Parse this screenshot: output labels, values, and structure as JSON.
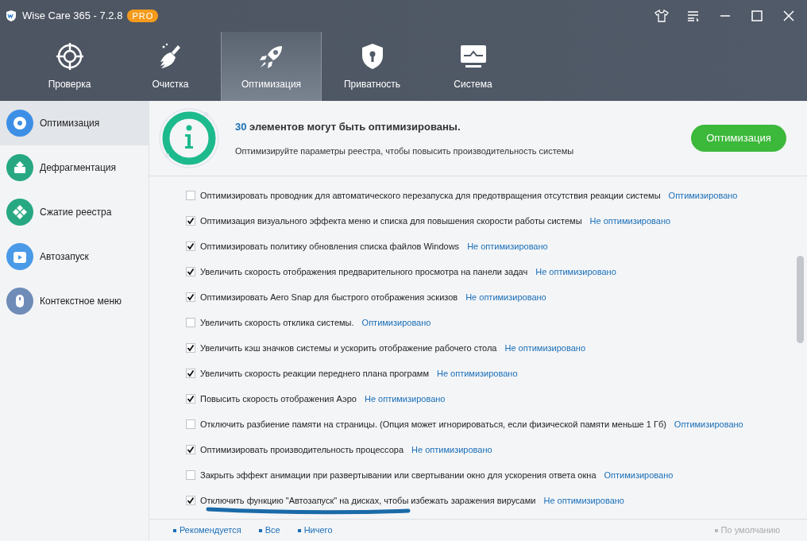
{
  "window": {
    "title": "Wise Care 365 - 7.2.8",
    "badge": "PRO"
  },
  "tabs": [
    {
      "label": "Проверка",
      "selected": false
    },
    {
      "label": "Очистка",
      "selected": false
    },
    {
      "label": "Оптимизация",
      "selected": true
    },
    {
      "label": "Приватность",
      "selected": false
    },
    {
      "label": "Система",
      "selected": false
    }
  ],
  "sidebar": {
    "items": [
      {
        "label": "Оптимизация",
        "color": "#3d8fe6",
        "selected": true
      },
      {
        "label": "Дефрагментация",
        "color": "#27a882",
        "selected": false
      },
      {
        "label": "Сжатие реестра",
        "color": "#27a882",
        "selected": false
      },
      {
        "label": "Автозапуск",
        "color": "#4a9ae8",
        "selected": false
      },
      {
        "label": "Контекстное меню",
        "color": "#6f8cb8",
        "selected": false
      }
    ]
  },
  "summary": {
    "count": "30",
    "title": "элементов могут быть оптимизированы.",
    "subtitle": "Оптимизируйте параметры реестра, чтобы повысить производительность системы",
    "button": "Оптимизация"
  },
  "items": [
    {
      "label": "Оптимизировать проводник для автоматического перезапуска для предотвращения отсутствия реакции системы",
      "status": "Оптимизировано",
      "checked": false
    },
    {
      "label": "Оптимизация визуального эффекта меню и списка для повышения скорости работы системы",
      "status": "Не оптимизировано",
      "checked": true
    },
    {
      "label": "Оптимизировать политику обновления списка файлов Windows",
      "status": "Не оптимизировано",
      "checked": true
    },
    {
      "label": "Увеличить скорость отображения предварительного просмотра на панели задач",
      "status": "Не оптимизировано",
      "checked": true
    },
    {
      "label": "Оптимизировать Aero Snap для быстрого отображения эскизов",
      "status": "Не оптимизировано",
      "checked": true
    },
    {
      "label": "Увеличить скорость отклика системы.",
      "status": "Оптимизировано",
      "checked": false
    },
    {
      "label": "Увеличить кэш значков системы и ускорить отображение рабочего стола",
      "status": "Не оптимизировано",
      "checked": true
    },
    {
      "label": "Увеличить скорость реакции переднего плана программ",
      "status": "Не оптимизировано",
      "checked": true
    },
    {
      "label": "Повысить скорость отображения Аэро",
      "status": "Не оптимизировано",
      "checked": true
    },
    {
      "label": "Отключить разбиение памяти на страницы. (Опция может игнорироваться, если физической памяти меньше 1 Гб)",
      "status": "Оптимизировано",
      "checked": false
    },
    {
      "label": "Оптимизировать производительность процессора",
      "status": "Не оптимизировано",
      "checked": true
    },
    {
      "label": "Закрыть эффект анимации при развертывании или свертывании окно для ускорения ответа окна",
      "status": "Оптимизировано",
      "checked": false
    },
    {
      "label": "Отключить функцию \"Автозапуск\" на дисках, чтобы избежать заражения вирусами",
      "status": "Не оптимизировано",
      "checked": true,
      "underlined": true
    }
  ],
  "footer": {
    "links": [
      "Рекомендуется",
      "Все",
      "Ничего"
    ],
    "default": "По умолчанию"
  }
}
